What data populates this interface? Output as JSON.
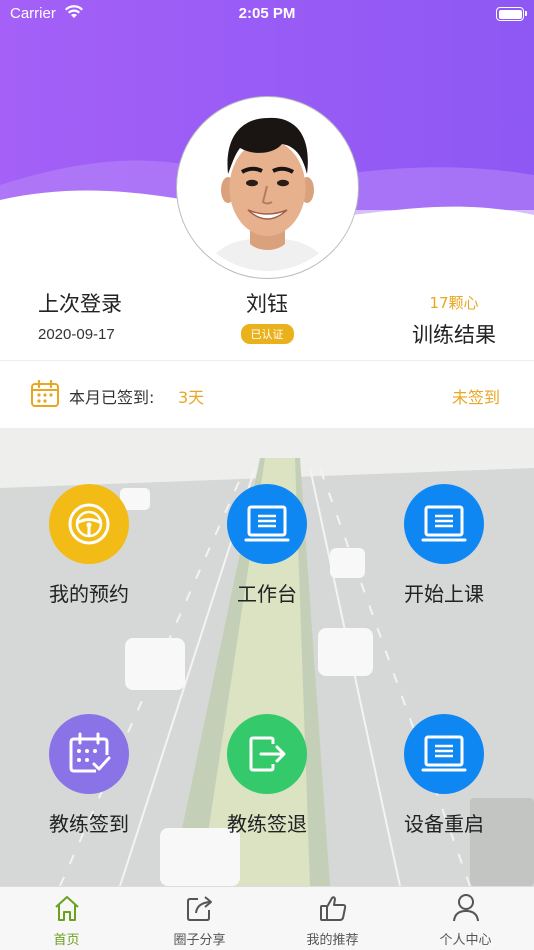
{
  "status_bar": {
    "carrier": "Carrier",
    "time": "2:05 PM"
  },
  "profile": {
    "last_login_label": "上次登录",
    "last_login_date": "2020-09-17",
    "name": "刘钰",
    "verified_badge": "已认证",
    "training_value": "17颗心",
    "training_label": "训练结果"
  },
  "signin": {
    "label": "本月已签到:",
    "days": "3天",
    "status": "未签到"
  },
  "menu": [
    {
      "label": "我的预约",
      "icon": "steering-wheel-icon",
      "color": "#f2bb16"
    },
    {
      "label": "工作台",
      "icon": "monitor-icon",
      "color": "#0f87f2"
    },
    {
      "label": "开始上课",
      "icon": "monitor-icon",
      "color": "#0f87f2"
    },
    {
      "label": "教练签到",
      "icon": "calendar-check-icon",
      "color": "#8a73e6"
    },
    {
      "label": "教练签退",
      "icon": "sign-out-icon",
      "color": "#34c96a"
    },
    {
      "label": "设备重启",
      "icon": "monitor-icon",
      "color": "#0f87f2"
    }
  ],
  "tabs": [
    {
      "label": "首页",
      "icon": "home-icon",
      "active": true
    },
    {
      "label": "圈子分享",
      "icon": "share-icon",
      "active": false
    },
    {
      "label": "我的推荐",
      "icon": "thumbs-up-icon",
      "active": false
    },
    {
      "label": "个人中心",
      "icon": "person-icon",
      "active": false
    }
  ],
  "colors": {
    "header_purple": "#9a5cf5",
    "accent_orange": "#e9a623",
    "active_tab_green": "#6aa11e"
  }
}
